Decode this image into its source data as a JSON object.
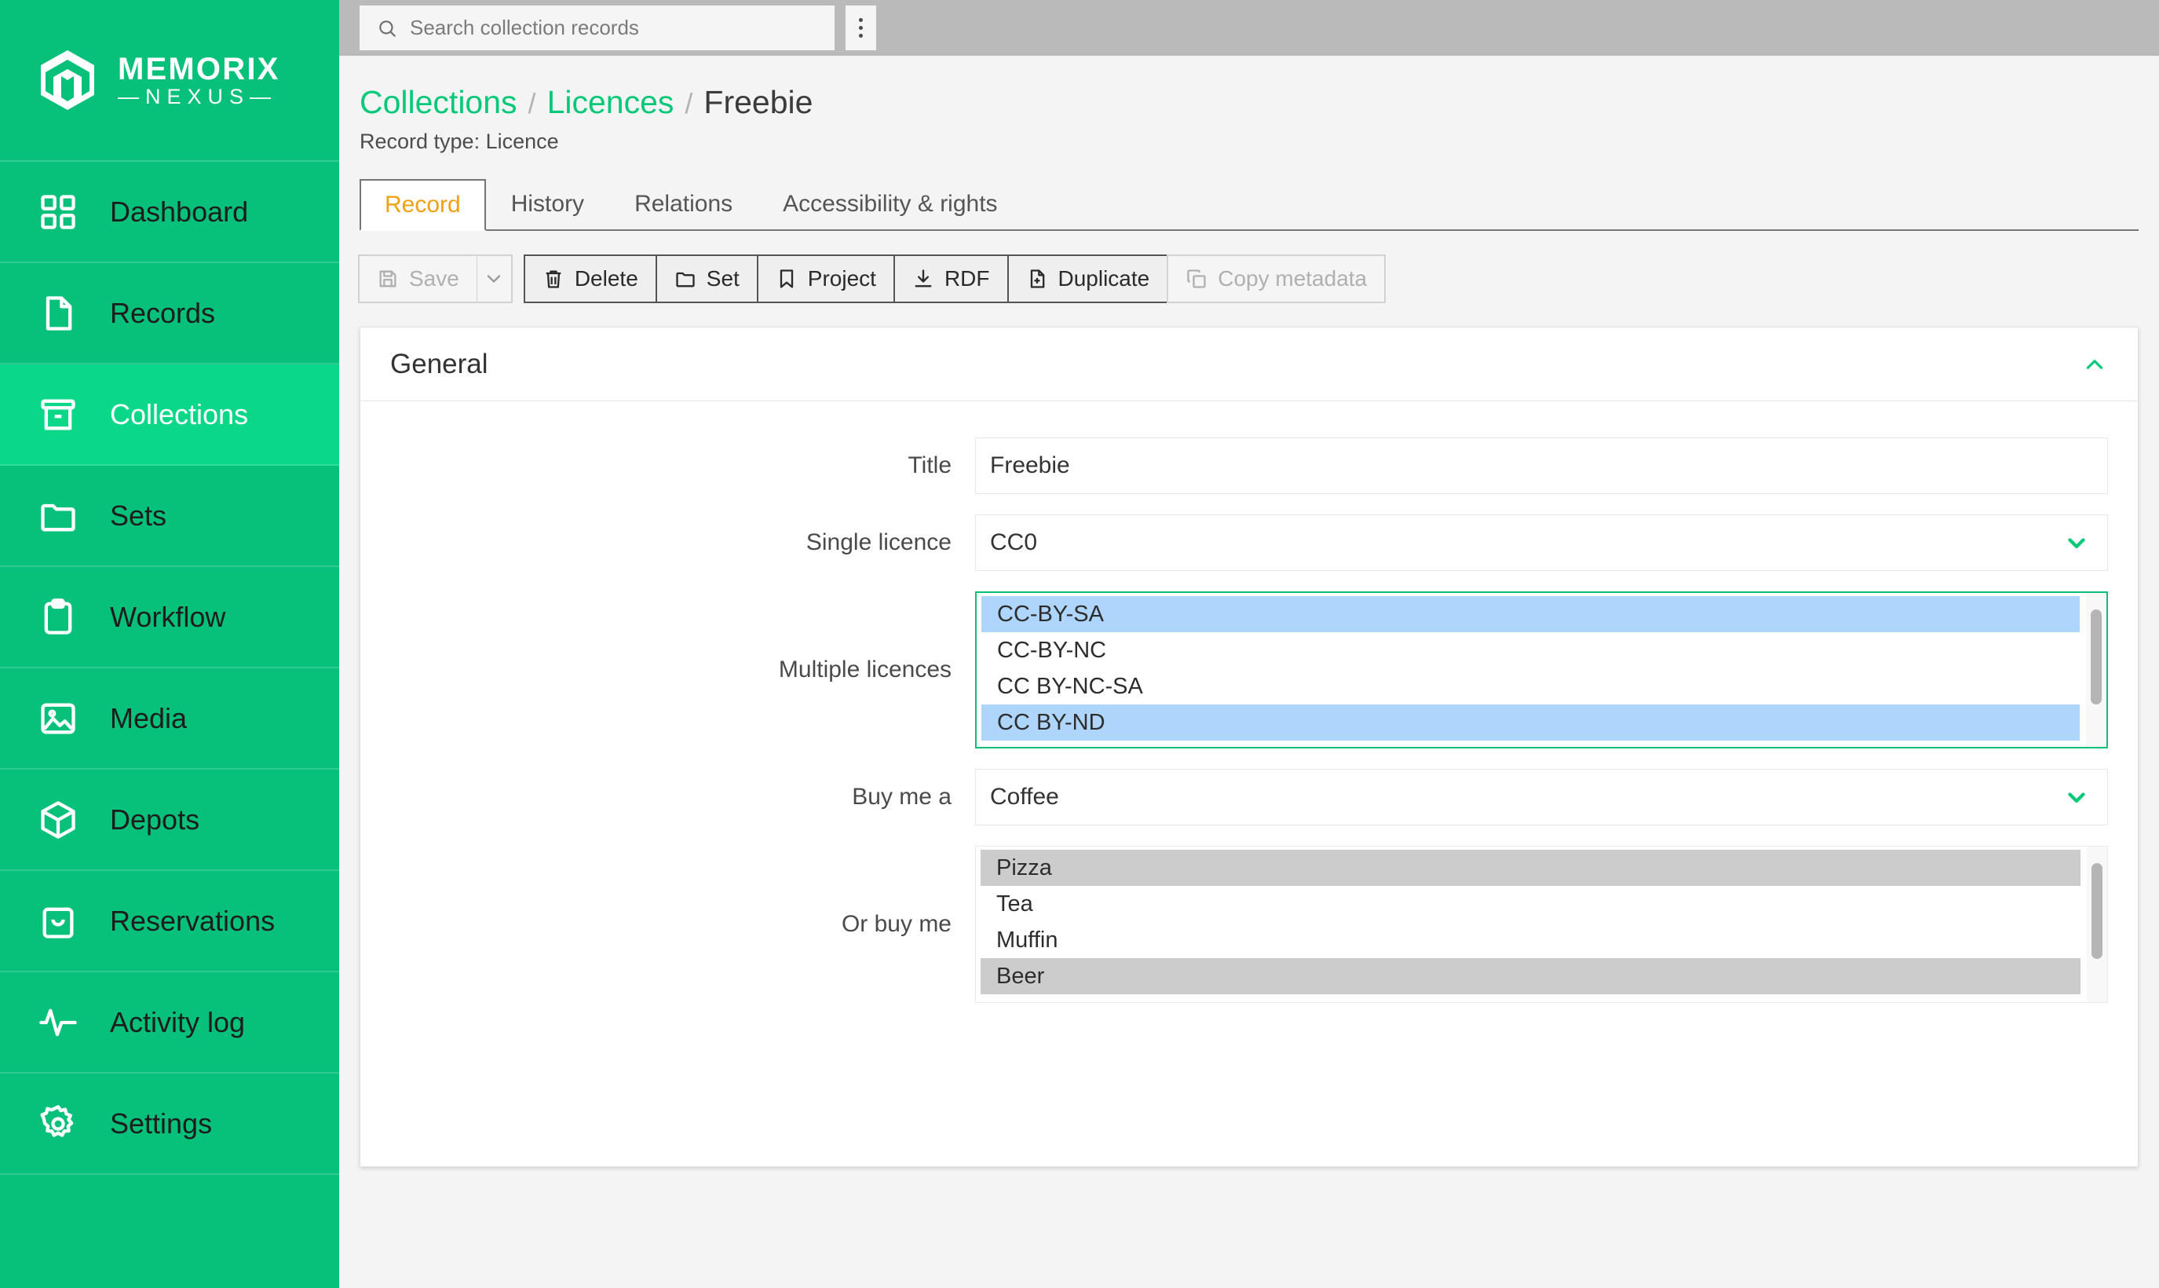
{
  "brand": {
    "name": "MEMORIX",
    "sub": "—NEXUS—"
  },
  "colors": {
    "sidebar_green": "#07c07a",
    "sidebar_active_green": "#0ad888",
    "accent_green": "#05c878",
    "tab_active_orange": "#f0a010",
    "selection_blue": "#aed5fb",
    "selection_grey": "#cccccc",
    "topbar_grey": "#bababa"
  },
  "sidebar": {
    "items": [
      {
        "label": "Dashboard",
        "icon": "grid-icon",
        "active": false
      },
      {
        "label": "Records",
        "icon": "file-icon",
        "active": false
      },
      {
        "label": "Collections",
        "icon": "archive-box-icon",
        "active": true
      },
      {
        "label": "Sets",
        "icon": "folder-icon",
        "active": false
      },
      {
        "label": "Workflow",
        "icon": "clipboard-icon",
        "active": false
      },
      {
        "label": "Media",
        "icon": "image-icon",
        "active": false
      },
      {
        "label": "Depots",
        "icon": "package-icon",
        "active": false
      },
      {
        "label": "Reservations",
        "icon": "basket-icon",
        "active": false
      },
      {
        "label": "Activity log",
        "icon": "pulse-icon",
        "active": false
      },
      {
        "label": "Settings",
        "icon": "gear-icon",
        "active": false
      }
    ]
  },
  "topbar": {
    "search": {
      "placeholder": "Search collection records",
      "value": "",
      "icon": "search-icon"
    },
    "kebab_icon": "kebab-menu-icon"
  },
  "breadcrumb": {
    "items": [
      {
        "label": "Collections",
        "link": true
      },
      {
        "label": "Licences",
        "link": true
      },
      {
        "label": "Freebie",
        "link": false
      }
    ],
    "separator": "/"
  },
  "record_type": "Record type: Licence",
  "tabs": [
    {
      "label": "Record",
      "active": true
    },
    {
      "label": "History",
      "active": false
    },
    {
      "label": "Relations",
      "active": false
    },
    {
      "label": "Accessibility & rights",
      "active": false
    }
  ],
  "toolbar": {
    "save": {
      "label": "Save",
      "icon": "save-disk-icon",
      "disabled": true
    },
    "save_caret": {
      "icon": "chevron-down-icon"
    },
    "delete": {
      "label": "Delete",
      "icon": "trash-icon",
      "disabled": false
    },
    "set": {
      "label": "Set",
      "icon": "folder-icon",
      "disabled": false
    },
    "project": {
      "label": "Project",
      "icon": "bookmark-icon",
      "disabled": false
    },
    "rdf": {
      "label": "RDF",
      "icon": "download-icon",
      "disabled": false
    },
    "duplicate": {
      "label": "Duplicate",
      "icon": "file-plus-icon",
      "disabled": false
    },
    "copy_metadata": {
      "label": "Copy metadata",
      "icon": "copy-icon",
      "disabled": true
    }
  },
  "card": {
    "title": "General",
    "collapse_icon": "chevron-up-icon"
  },
  "fields": {
    "title": {
      "label": "Title",
      "value": "Freebie"
    },
    "single_licence": {
      "label": "Single licence",
      "value": "CC0",
      "chevron_icon": "chevron-down-icon"
    },
    "multiple_licences": {
      "label": "Multiple licences",
      "focused": true,
      "options": [
        {
          "label": "CC-BY-SA",
          "selected": true
        },
        {
          "label": "CC-BY-NC",
          "selected": false
        },
        {
          "label": "CC BY-NC-SA",
          "selected": false
        },
        {
          "label": "CC BY-ND",
          "selected": true
        }
      ]
    },
    "buy_me_a": {
      "label": "Buy me a",
      "value": "Coffee",
      "chevron_icon": "chevron-down-icon"
    },
    "or_buy_me": {
      "label": "Or buy me",
      "focused": false,
      "options": [
        {
          "label": "Pizza",
          "selected": true
        },
        {
          "label": "Tea",
          "selected": false
        },
        {
          "label": "Muffin",
          "selected": false
        },
        {
          "label": "Beer",
          "selected": true
        }
      ]
    }
  }
}
